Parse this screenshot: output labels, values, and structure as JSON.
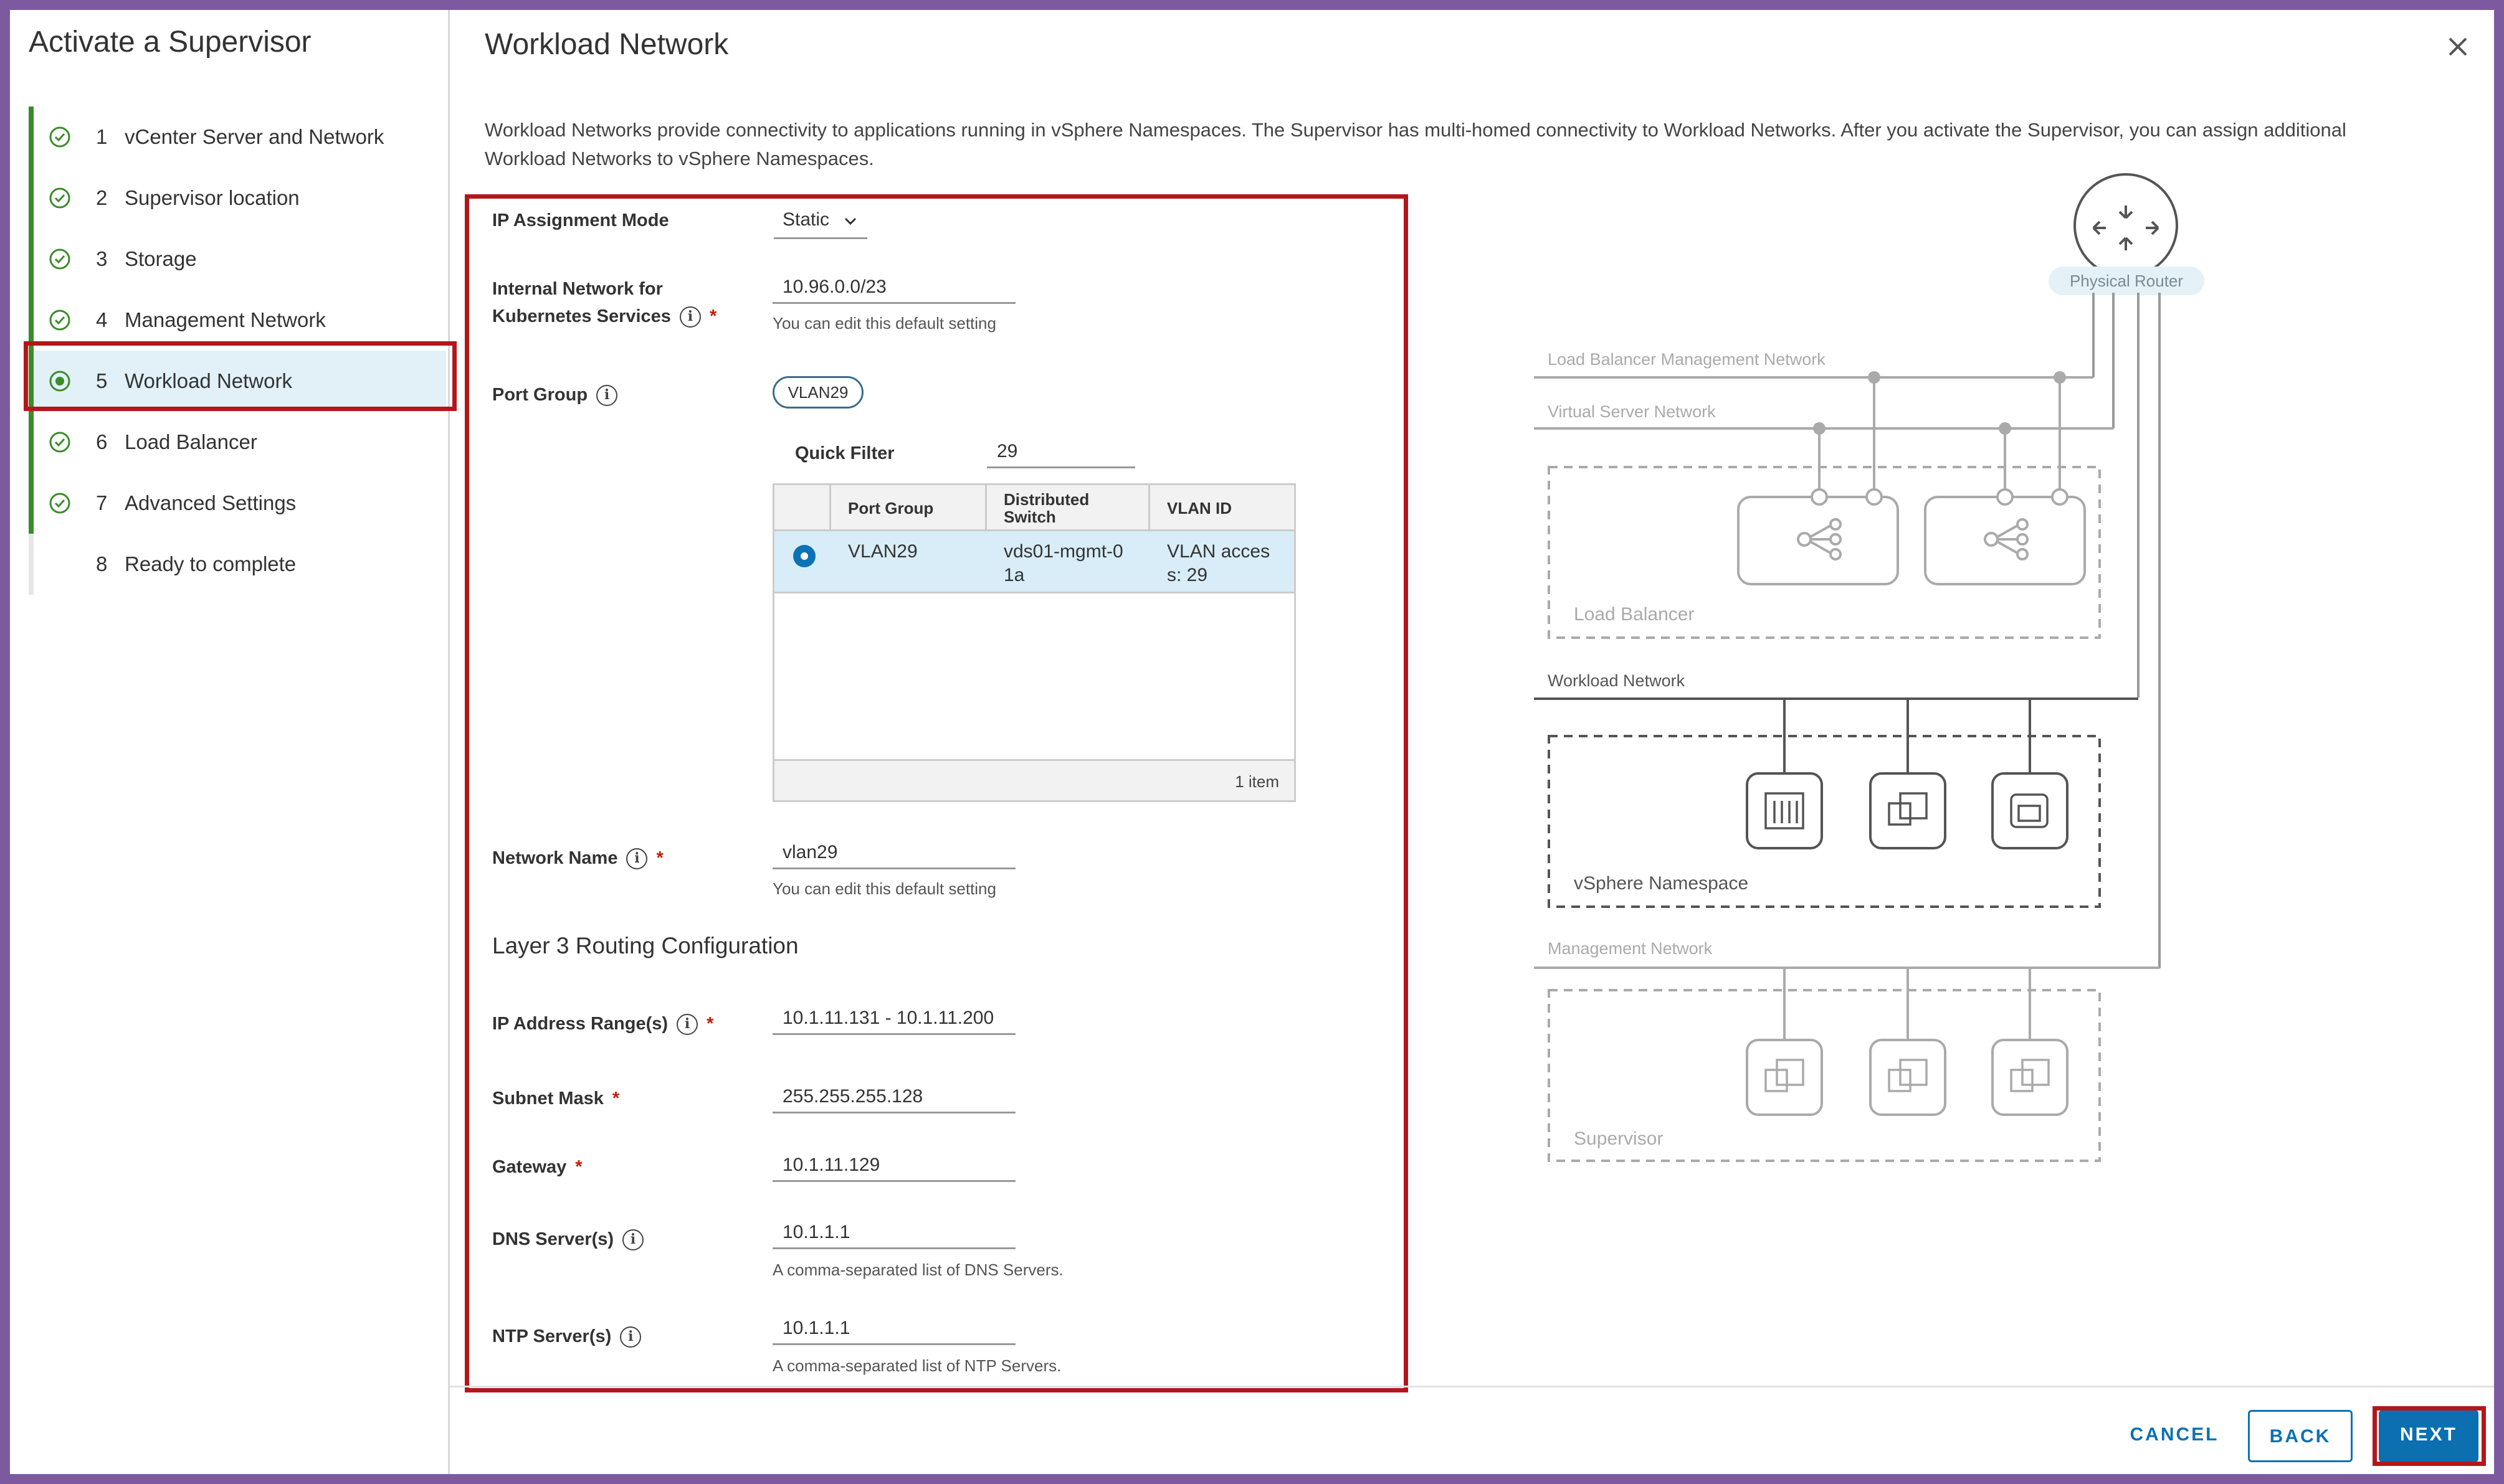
{
  "wizard": {
    "title": "Activate a Supervisor",
    "steps": [
      {
        "num": "1",
        "label": "vCenter Server and Network",
        "status": "complete"
      },
      {
        "num": "2",
        "label": "Supervisor location",
        "status": "complete"
      },
      {
        "num": "3",
        "label": "Storage",
        "status": "complete"
      },
      {
        "num": "4",
        "label": "Management Network",
        "status": "complete"
      },
      {
        "num": "5",
        "label": "Workload Network",
        "status": "current"
      },
      {
        "num": "6",
        "label": "Load Balancer",
        "status": "complete"
      },
      {
        "num": "7",
        "label": "Advanced Settings",
        "status": "complete"
      },
      {
        "num": "8",
        "label": "Ready to complete",
        "status": "pending"
      }
    ]
  },
  "page": {
    "title": "Workload Network",
    "description": "Workload Networks provide connectivity to applications running in vSphere Namespaces. The Supervisor has multi-homed connectivity to Workload Networks. After you activate the Supervisor, you can assign additional Workload Networks to vSphere Namespaces."
  },
  "form": {
    "ip_mode": {
      "label": "IP Assignment Mode",
      "value": "Static"
    },
    "internal_network": {
      "label_line1": "Internal Network for",
      "label_line2": "Kubernetes Services",
      "value": "10.96.0.0/23",
      "hint": "You can edit this default setting"
    },
    "port_group": {
      "label": "Port Group",
      "selected_pill": "VLAN29"
    },
    "quick_filter": {
      "label": "Quick Filter",
      "value": "29"
    },
    "grid": {
      "headers": {
        "port_group": "Port Group",
        "switch_line1": "Distributed",
        "switch_line2": "Switch",
        "vlan_id": "VLAN ID"
      },
      "row": {
        "port_group": "VLAN29",
        "switch_line1": "vds01-mgmt-0",
        "switch_line2": "1a",
        "vlan_line1": "VLAN acces",
        "vlan_line2": "s: 29"
      },
      "footer": "1 item"
    },
    "network_name": {
      "label": "Network Name",
      "value": "vlan29",
      "hint": "You can edit this default setting"
    },
    "layer3_title": "Layer 3 Routing Configuration",
    "ip_range": {
      "label": "IP Address Range(s)",
      "value": "10.1.11.131 - 10.1.11.200"
    },
    "subnet_mask": {
      "label": "Subnet Mask",
      "value": "255.255.255.128"
    },
    "gateway": {
      "label": "Gateway",
      "value": "10.1.11.129"
    },
    "dns": {
      "label": "DNS Server(s)",
      "value": "10.1.1.1",
      "hint": "A comma-separated list of DNS Servers."
    },
    "ntp": {
      "label": "NTP Server(s)",
      "value": "10.1.1.1",
      "hint": "A comma-separated list of NTP Servers."
    }
  },
  "diagram": {
    "router": "Physical Router",
    "lb_mgmt_net": "Load Balancer Management Network",
    "virtual_server_net": "Virtual Server Network",
    "load_balancer": "Load Balancer",
    "workload_net": "Workload Network",
    "namespace": "vSphere Namespace",
    "mgmt_net": "Management Network",
    "supervisor": "Supervisor"
  },
  "buttons": {
    "cancel": "CANCEL",
    "back": "BACK",
    "next": "NEXT"
  },
  "colors": {
    "accent": "#0b72b5",
    "highlight": "#b4161b",
    "complete": "#3a8c2a",
    "frame": "#7d5aa0"
  }
}
